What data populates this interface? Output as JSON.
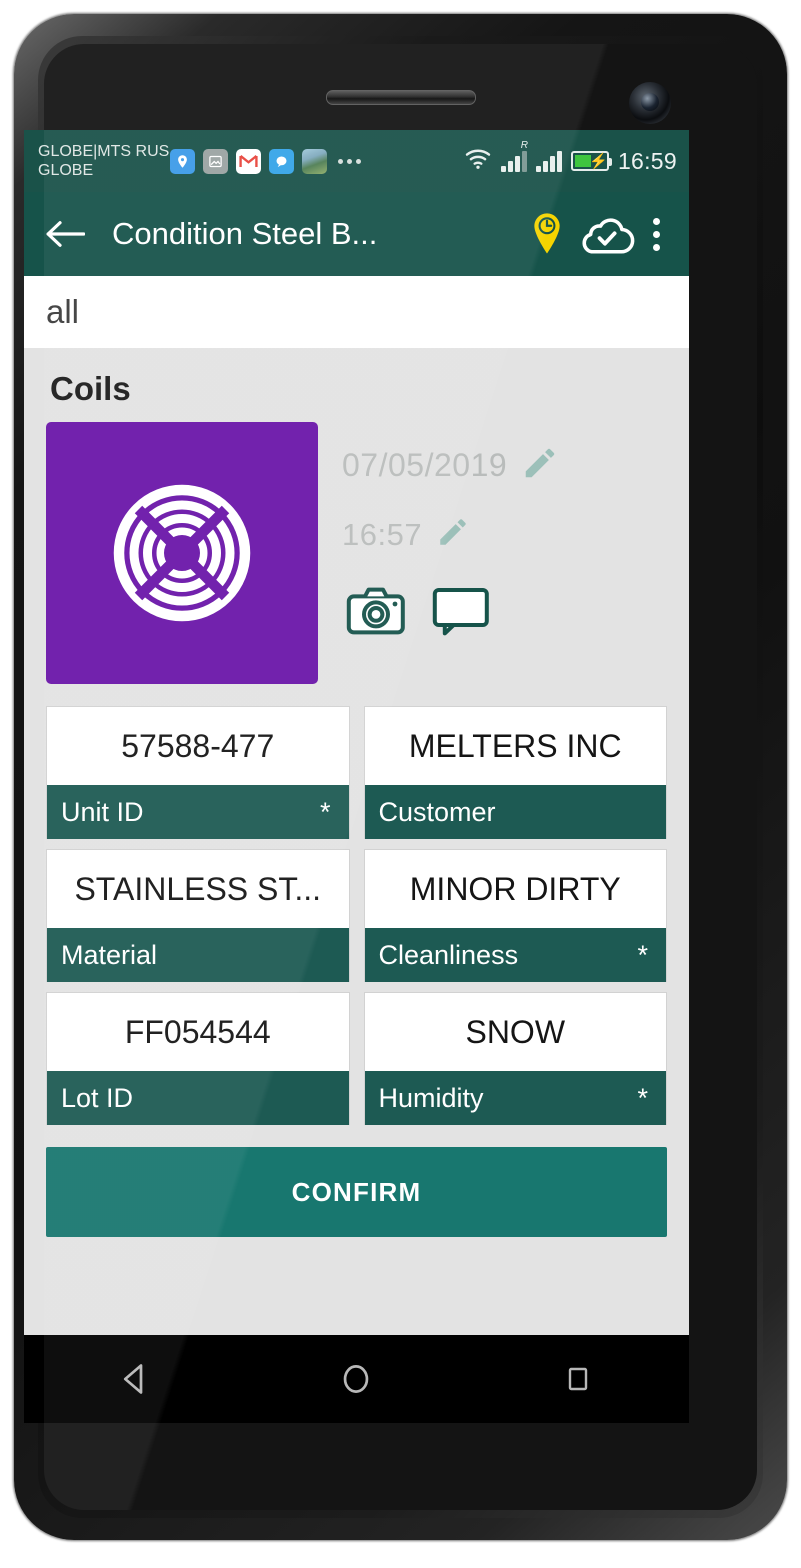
{
  "status_bar": {
    "carrier": "GLOBE|MTS RUS\nGLOBE",
    "clock": "16:59",
    "roaming_indicator": "R",
    "notification_icons": [
      "maps-pin-icon",
      "photo-icon",
      "gmail-icon",
      "chat-bubble-icon",
      "image-thumbnail-icon",
      "more-dots-icon"
    ]
  },
  "app_bar": {
    "back_label": "back-arrow-icon",
    "title": "Condition Steel B...",
    "location_pin_label": "location-clock-pin-icon",
    "sync_label": "cloud-check-icon",
    "overflow_label": "overflow-menu-icon"
  },
  "search": {
    "value": "all",
    "placeholder": "all"
  },
  "content": {
    "section_title": "Coils",
    "item": {
      "thumbnail_icon": "coil-icon",
      "thumbnail_color": "#6a15a8",
      "date": "07/05/2019",
      "time": "16:57",
      "edit_date_label": "pencil-icon",
      "edit_time_label": "pencil-icon",
      "camera_label": "camera-icon",
      "comment_label": "comment-icon"
    },
    "fields": [
      {
        "value": "57588-477",
        "label": "Unit ID",
        "required": "*"
      },
      {
        "value": "MELTERS INC",
        "label": "Customer",
        "required": ""
      },
      {
        "value": "STAINLESS ST...",
        "label": "Material",
        "required": ""
      },
      {
        "value": "MINOR DIRTY",
        "label": "Cleanliness",
        "required": "*"
      },
      {
        "value": "FF054544",
        "label": "Lot ID",
        "required": ""
      },
      {
        "value": "SNOW",
        "label": "Humidity",
        "required": "*"
      }
    ],
    "confirm_label": "CONFIRM"
  },
  "nav_bar": {
    "back_label": "nav-back-icon",
    "home_label": "nav-home-icon",
    "recents_label": "nav-recents-icon"
  },
  "colors": {
    "app_bar_teal": "#16534a",
    "status_bar_teal": "#1a5249",
    "label_teal": "#1d5a53",
    "confirm_teal": "#18776f",
    "tile_purple": "#6a15a8",
    "accent_yellow": "#f5d400",
    "content_gray": "#e3e3e3"
  }
}
